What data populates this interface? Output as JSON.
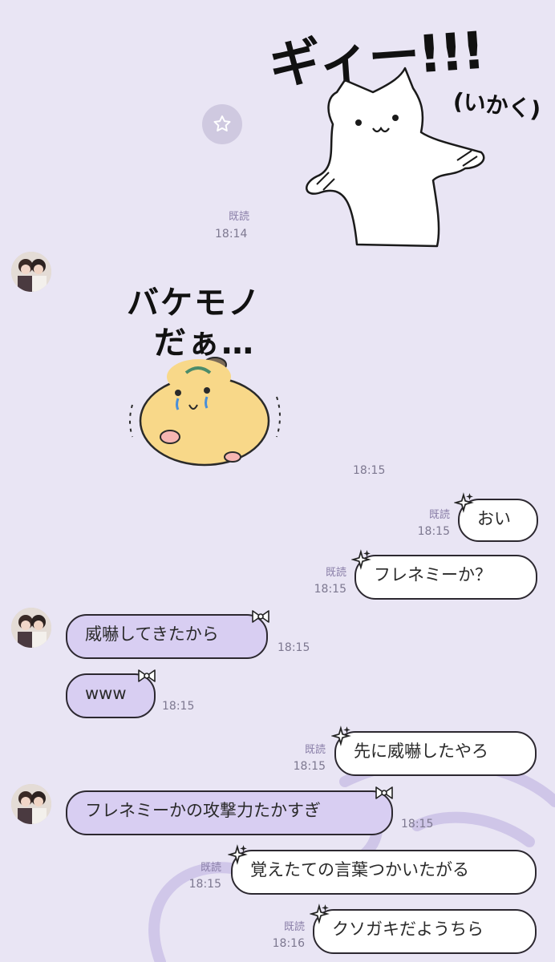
{
  "sticker_cat": {
    "text_main": "ギィー!!!",
    "text_sub": "(いかく)"
  },
  "sticker_hamster": {
    "line1": "バケモノ",
    "line2": "だぁ…"
  },
  "icons": {
    "star": "star-icon",
    "sparkle": "sparkle-icon",
    "bow": "bow-icon"
  },
  "colors": {
    "background": "#e9e5f4",
    "bubble_out": "#ffffff",
    "bubble_in": "#d8cef2",
    "read_label": "#8a7fa8"
  },
  "messages": [
    {
      "id": "m0",
      "side": "out",
      "type": "sticker",
      "read": "既読",
      "time": "18:14"
    },
    {
      "id": "m1",
      "side": "in",
      "type": "sticker",
      "time": "18:15"
    },
    {
      "id": "m2",
      "side": "out",
      "text": "おい",
      "read": "既読",
      "time": "18:15"
    },
    {
      "id": "m3",
      "side": "out",
      "text": "フレネミーか？",
      "read": "既読",
      "time": "18:15"
    },
    {
      "id": "m4",
      "side": "in",
      "text": "威嚇してきたから",
      "time": "18:15"
    },
    {
      "id": "m5",
      "side": "in",
      "text": "www",
      "time": "18:15"
    },
    {
      "id": "m6",
      "side": "out",
      "text": "先に威嚇したやろ",
      "read": "既読",
      "time": "18:15"
    },
    {
      "id": "m7",
      "side": "in",
      "text": "フレネミーかの攻撃力たかすぎ",
      "time": "18:15"
    },
    {
      "id": "m8",
      "side": "out",
      "text": "覚えたての言葉つかいたがる",
      "read": "既読",
      "time": "18:15"
    },
    {
      "id": "m9",
      "side": "out",
      "text": "クソガキだようちら",
      "read": "既読",
      "time": "18:16"
    }
  ]
}
